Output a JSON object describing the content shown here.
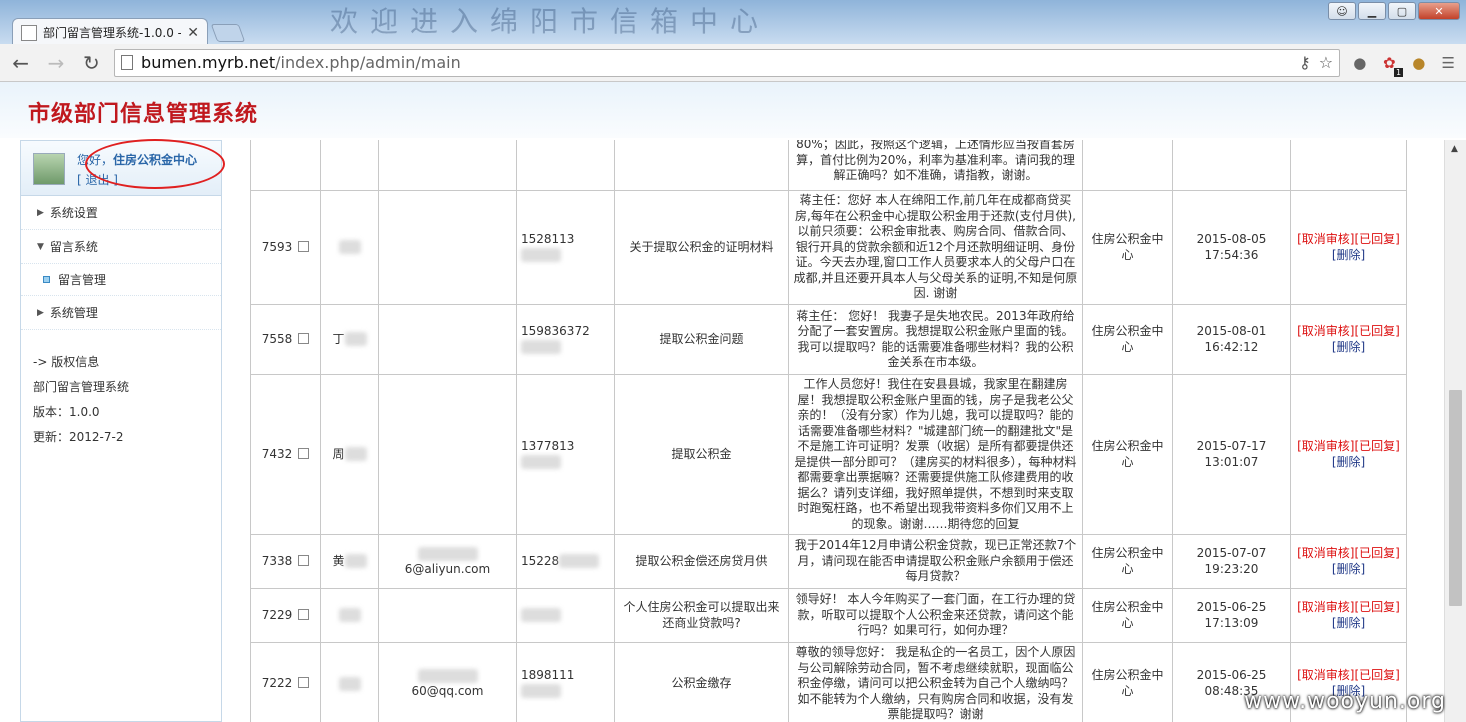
{
  "browser": {
    "tab_title": "部门留言管理系统-1.0.0 -",
    "url_host": "bumen.myrb.net",
    "url_path": "/index.php/admin/main",
    "banner": "欢迎进入绵阳市信箱中心"
  },
  "header": {
    "title": "市级部门信息管理系统"
  },
  "sidebar": {
    "greeting_prefix": "您好，",
    "user": "住房公积金中心",
    "logout": "[   退出   ]",
    "menu": [
      {
        "label": "系统设置"
      },
      {
        "label": "留言系统"
      },
      {
        "label": "留言管理"
      },
      {
        "label": "系统管理"
      }
    ],
    "info": {
      "head": "-> 版权信息",
      "name": "部门留言管理系统",
      "version": "版本：1.0.0",
      "updated": "更新：2012-7-2"
    }
  },
  "rows": [
    {
      "id": "",
      "name": "",
      "email": "",
      "phone": "",
      "subject": "",
      "content": "80%；因此，按照这个逻辑，上述情形应当按首套房算，首付比例为20%，利率为基准利率。请问我的理解正确吗？如不准确，请指教，谢谢。",
      "dept": "",
      "date": "",
      "time": "",
      "ops": false
    },
    {
      "id": "7593",
      "name": "",
      "email": "",
      "phone": "1528113",
      "subject": "关于提取公积金的证明材料",
      "content": "蒋主任：您好 本人在绵阳工作,前几年在成都商贷买房,每年在公积金中心提取公积金用于还款(支付月供),以前只须要：公积金审批表、购房合同、借款合同、银行开具的贷款余额和近12个月还款明细证明、身份证。今天去办理,窗口工作人员要求本人的父母户口在成都,并且还要开具本人与父母关系的证明,不知是何原因. 谢谢",
      "dept": "住房公积金中心",
      "date": "2015-08-05",
      "time": "17:54:36",
      "ops": true
    },
    {
      "id": "7558",
      "name": "丁",
      "email": "",
      "phone": "159836372",
      "subject": "提取公积金问题",
      "content": "蒋主任：    您好！ 我妻子是失地农民。2013年政府给分配了一套安置房。我想提取公积金账户里面的钱。我可以提取吗？能的话需要准备哪些材料？我的公积金关系在市本级。",
      "dept": "住房公积金中心",
      "date": "2015-08-01",
      "time": "16:42:12",
      "ops": true
    },
    {
      "id": "7432",
      "name": "周",
      "email": "",
      "phone": "1377813",
      "subject": "提取公积金",
      "content": "工作人员您好！我住在安县县城，我家里在翻建房屋！我想提取公积金账户里面的钱，房子是我老公父亲的！（没有分家）作为儿媳，我可以提取吗？能的话需要准备哪些材料？\"城建部门统一的翻建批文\"是不是施工许可证明？发票（收据）是所有都要提供还是提供一部分即可？（建房买的材料很多），每种材料都需要拿出票据嘛？还需要提供施工队修建费用的收据么？请列支详细，我好照单提供，不想到时来支取时跑冤枉路，也不希望出现我带资料多你们又用不上的现象。谢谢……期待您的回复",
      "dept": "住房公积金中心",
      "date": "2015-07-17",
      "time": "13:01:07",
      "ops": true
    },
    {
      "id": "7338",
      "name": "黄",
      "email": "6@aliyun.com",
      "phone": "15228",
      "subject": "提取公积金偿还房贷月供",
      "content": "我于2014年12月申请公积金贷款，现已正常还款7个月，请问现在能否申请提取公积金账户余额用于偿还每月贷款？",
      "dept": "住房公积金中心",
      "date": "2015-07-07",
      "time": "19:23:20",
      "ops": true
    },
    {
      "id": "7229",
      "name": "",
      "email": "",
      "phone": "",
      "subject": "个人住房公积金可以提取出来还商业贷款吗?",
      "content": "领导好！ 本人今年购买了一套门面，在工行办理的贷款，听取可以提取个人公积金来还贷款，请问这个能行吗？如果可行，如何办理？",
      "dept": "住房公积金中心",
      "date": "2015-06-25",
      "time": "17:13:09",
      "ops": true
    },
    {
      "id": "7222",
      "name": "",
      "email": "60@qq.com",
      "phone": "1898111",
      "subject": "公积金缴存",
      "content": "尊敬的领导您好： 我是私企的一名员工，因个人原因与公司解除劳动合同，暂不考虑继续就职，现面临公积金停缴，请问可以把公积金转为自己个人缴纳吗？如不能转为个人缴纳，只有购房合同和收据，没有发票能提取吗？谢谢",
      "dept": "住房公积金中心",
      "date": "2015-06-25",
      "time": "08:48:35",
      "ops": true
    }
  ],
  "ops_labels": {
    "cancel": "[取消审核]",
    "replied": "[已回复]",
    "delete": "[删除]"
  },
  "watermark": "www.wooyun.org"
}
